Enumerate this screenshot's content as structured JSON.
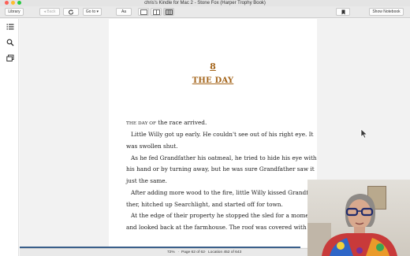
{
  "window": {
    "title": "chris's Kindle for Mac 2 - Stone Fox (Harper Trophy Book)"
  },
  "toolbar": {
    "library_label": "Library",
    "back_label": "Back",
    "goto_label": "Go to",
    "font_label": "Aa",
    "notebook_label": "Show Notebook"
  },
  "icons": {
    "refresh": "refresh-icon",
    "single_column": "single-column-icon",
    "two_column": "two-column-icon",
    "multi_column": "multi-column-icon",
    "bookmark": "bookmark-icon",
    "toc": "toc-icon",
    "search": "search-icon",
    "flashcards": "flashcards-icon"
  },
  "book": {
    "chapter_number": "8",
    "chapter_title": "THE DAY",
    "first_line_smallcaps": "The day of",
    "first_line_rest": " the race arrived.",
    "lines": [
      "Little Willy got up early. He couldn't see out of his right eye. It",
      "was swollen shut.",
      "As he fed Grandfather his oatmeal, he tried to hide his eye with",
      "his hand or by turning away, but he was sure Grandfather saw it",
      "just the same.",
      "After adding more wood to the fire, little Willy kissed Grandfa-",
      "ther, hitched up Searchlight, and started off for town.",
      "At the edge of their property he stopped the sled for a moment",
      "and looked back at the farmhouse. The roof was covered with"
    ]
  },
  "status": {
    "percent": "72%",
    "page": "Page 62 of 62",
    "location": "Location 452 of 643",
    "progress_fraction": 0.72
  },
  "colors": {
    "chapter_heading": "#a4651b",
    "progress_bar": "#3a5f8a"
  }
}
